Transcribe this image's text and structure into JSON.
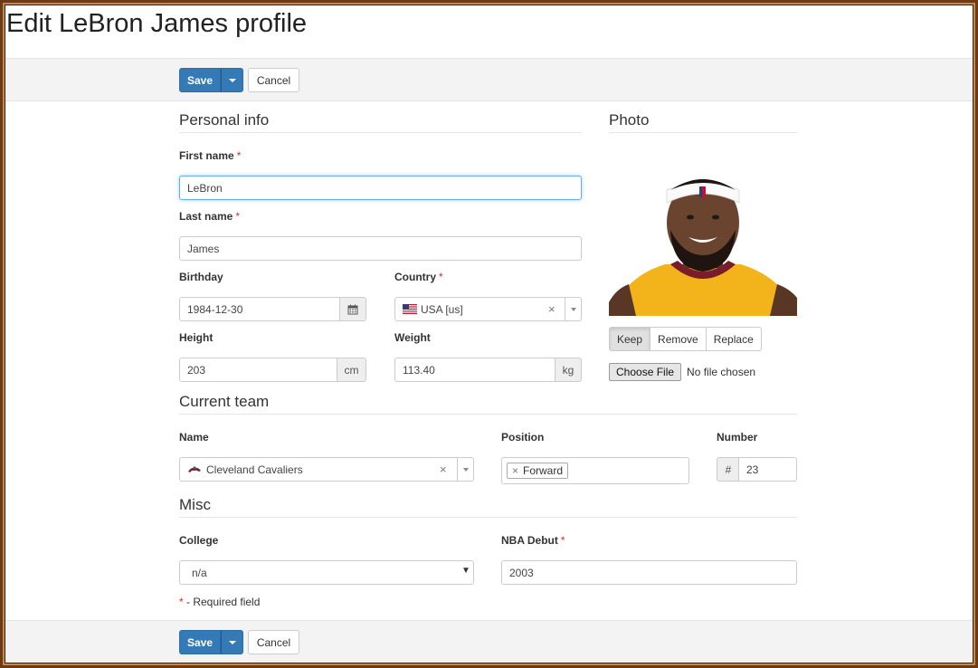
{
  "page": {
    "title": "Edit LeBron James profile"
  },
  "toolbar": {
    "save_label": "Save",
    "cancel_label": "Cancel"
  },
  "personal": {
    "section_title": "Personal info",
    "first_name": {
      "label": "First name",
      "value": "LeBron"
    },
    "last_name": {
      "label": "Last name",
      "value": "James"
    },
    "birthday": {
      "label": "Birthday",
      "value": "1984-12-30",
      "icon": "calendar-icon"
    },
    "country": {
      "label": "Country",
      "value": "USA [us]",
      "icon": "us-flag-icon"
    },
    "height": {
      "label": "Height",
      "value": "203",
      "unit": "cm"
    },
    "weight": {
      "label": "Weight",
      "value": "113.40",
      "unit": "kg"
    }
  },
  "photo": {
    "section_title": "Photo",
    "buttons": [
      "Keep",
      "Remove",
      "Replace"
    ],
    "active_button": "Keep",
    "choose_file_label": "Choose File",
    "no_file_text": "No file chosen"
  },
  "team": {
    "section_title": "Current team",
    "name": {
      "label": "Name",
      "value": "Cleveland Cavaliers"
    },
    "position": {
      "label": "Position",
      "tag": "Forward"
    },
    "number": {
      "label": "Number",
      "prefix": "#",
      "value": "23"
    }
  },
  "misc": {
    "section_title": "Misc",
    "college": {
      "label": "College",
      "value": "n/a"
    },
    "nba_debut": {
      "label": "NBA Debut",
      "value": "2003"
    }
  },
  "required_marker": "*",
  "footnote": {
    "marker": "*",
    "text": "- Required field"
  },
  "colors": {
    "primary": "#337ab7",
    "required": "#c9302c",
    "focus": "#66afe9"
  }
}
